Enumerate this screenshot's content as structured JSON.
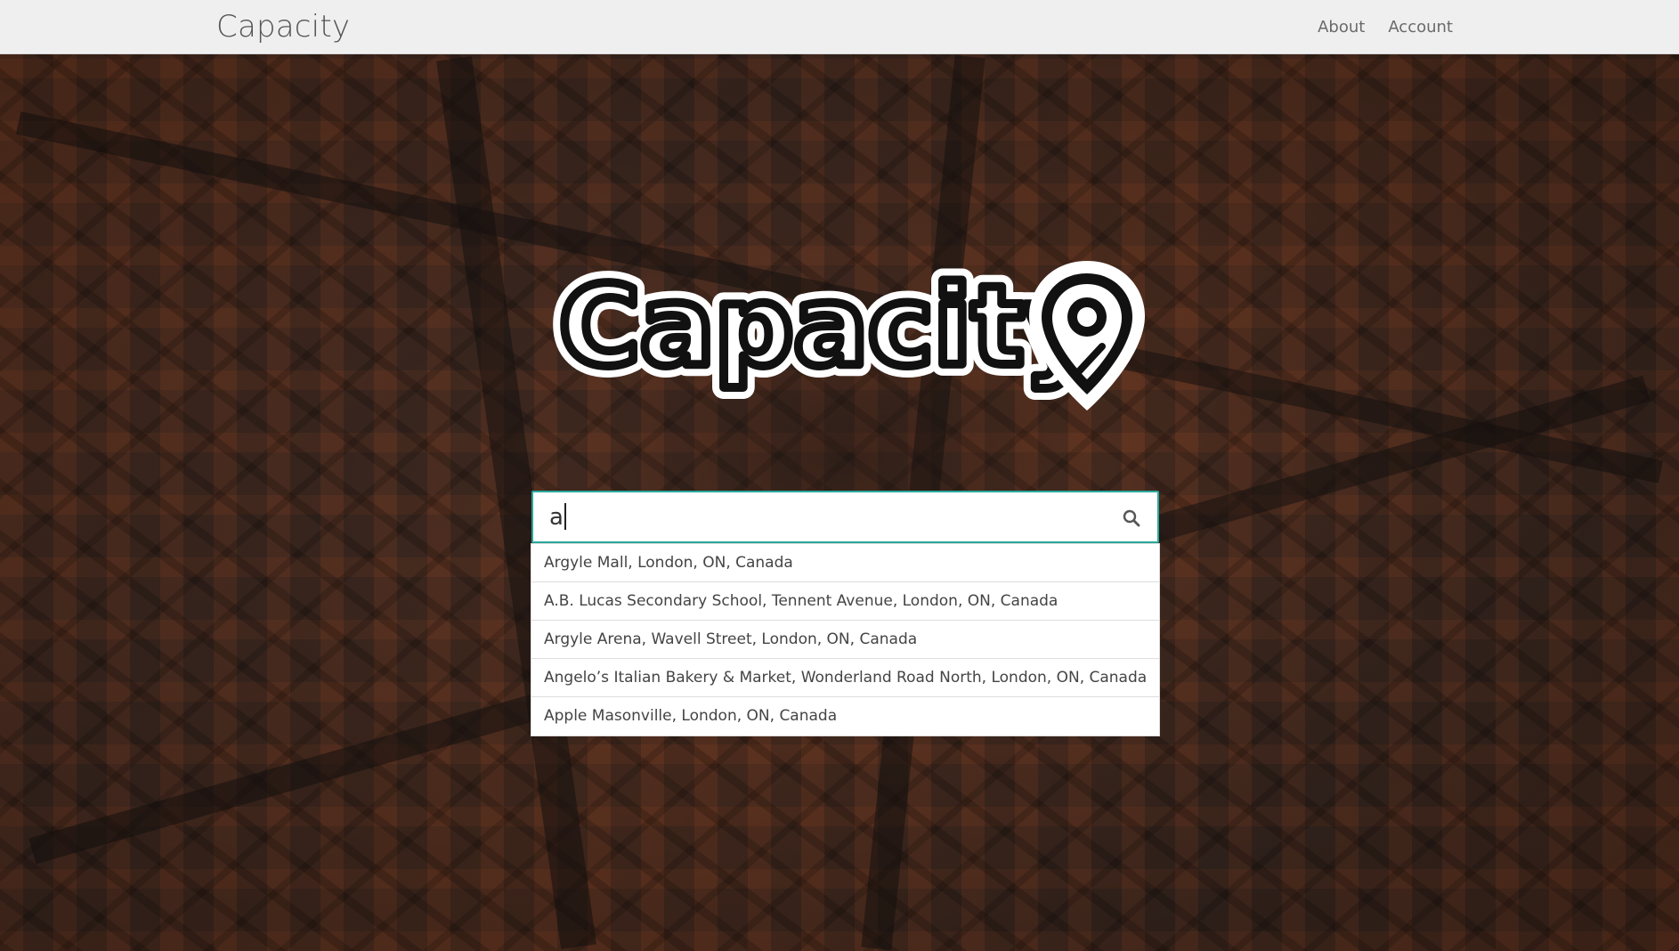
{
  "navbar": {
    "brand": "Capacity",
    "links": [
      {
        "label": "About"
      },
      {
        "label": "Account"
      }
    ]
  },
  "hero": {
    "logo_text": "Capacity",
    "logo_icon": "map-pin-icon"
  },
  "search": {
    "value": "a",
    "icon": "search-icon",
    "accent_color": "#2aa89c"
  },
  "suggestions": [
    {
      "label": "Argyle Mall, London, ON, Canada"
    },
    {
      "label": "A.B. Lucas Secondary School, Tennent Avenue, London, ON, Canada"
    },
    {
      "label": "Argyle Arena, Wavell Street, London, ON, Canada"
    },
    {
      "label": "Angelo’s Italian Bakery & Market, Wonderland Road North, London, ON, Canada"
    },
    {
      "label": "Apple Masonville, London, ON, Canada"
    }
  ]
}
